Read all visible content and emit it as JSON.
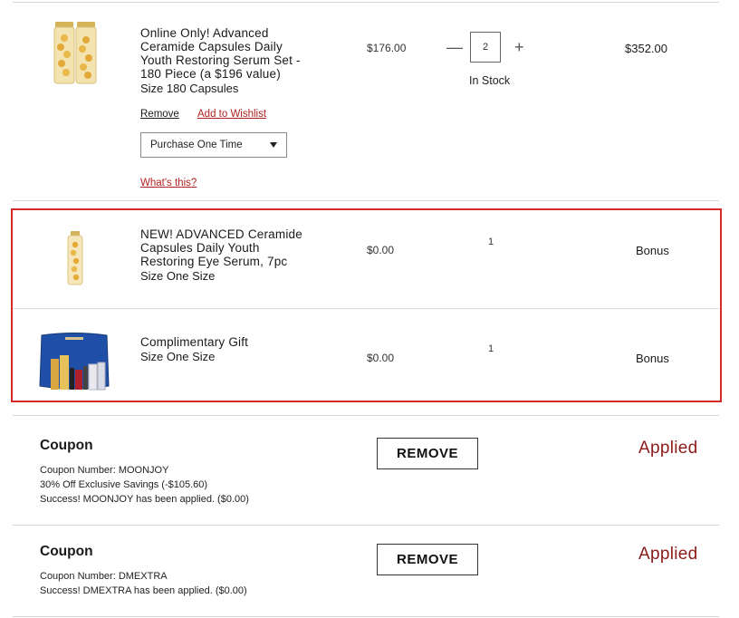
{
  "item1": {
    "name_lines": [
      "Online Only! Advanced",
      "Ceramide Capsules Daily",
      "Youth Restoring Serum Set -",
      "180 Piece (a $196 value)"
    ],
    "size": "Size 180 Capsules",
    "price": "$176.00",
    "quantity": "2",
    "decrease_symbol": "—",
    "increase_symbol": "+",
    "stock": "In Stock",
    "total": "$352.00",
    "remove_label": "Remove",
    "wishlist_label": "Add to Wishlist",
    "purchase_option": "Purchase One Time",
    "whats_this_label": "What's this?"
  },
  "item2": {
    "name_lines": [
      "NEW! ADVANCED Ceramide",
      "Capsules Daily Youth",
      "Restoring Eye Serum, 7pc"
    ],
    "size": "Size One Size",
    "price": "$0.00",
    "quantity": "1",
    "total": "Bonus"
  },
  "item3": {
    "name_lines": [
      "Complimentary Gift"
    ],
    "size": "Size One Size",
    "price": "$0.00",
    "quantity": "1",
    "total": "Bonus"
  },
  "coupon1": {
    "title": "Coupon",
    "lines": [
      "Coupon Number: MOONJOY",
      "30% Off Exclusive Savings (-$105.60)",
      "Success! MOONJOY has been applied. ($0.00)"
    ],
    "remove_label": "REMOVE",
    "status": "Applied"
  },
  "coupon2": {
    "title": "Coupon",
    "lines": [
      "Coupon Number: DMEXTRA",
      "Success! DMEXTRA has been applied. ($0.00)"
    ],
    "remove_label": "REMOVE",
    "status": "Applied"
  },
  "colors": {
    "accent": "#8b1a1a",
    "link_red": "#b22222",
    "highlight_border": "#d42a2a"
  }
}
